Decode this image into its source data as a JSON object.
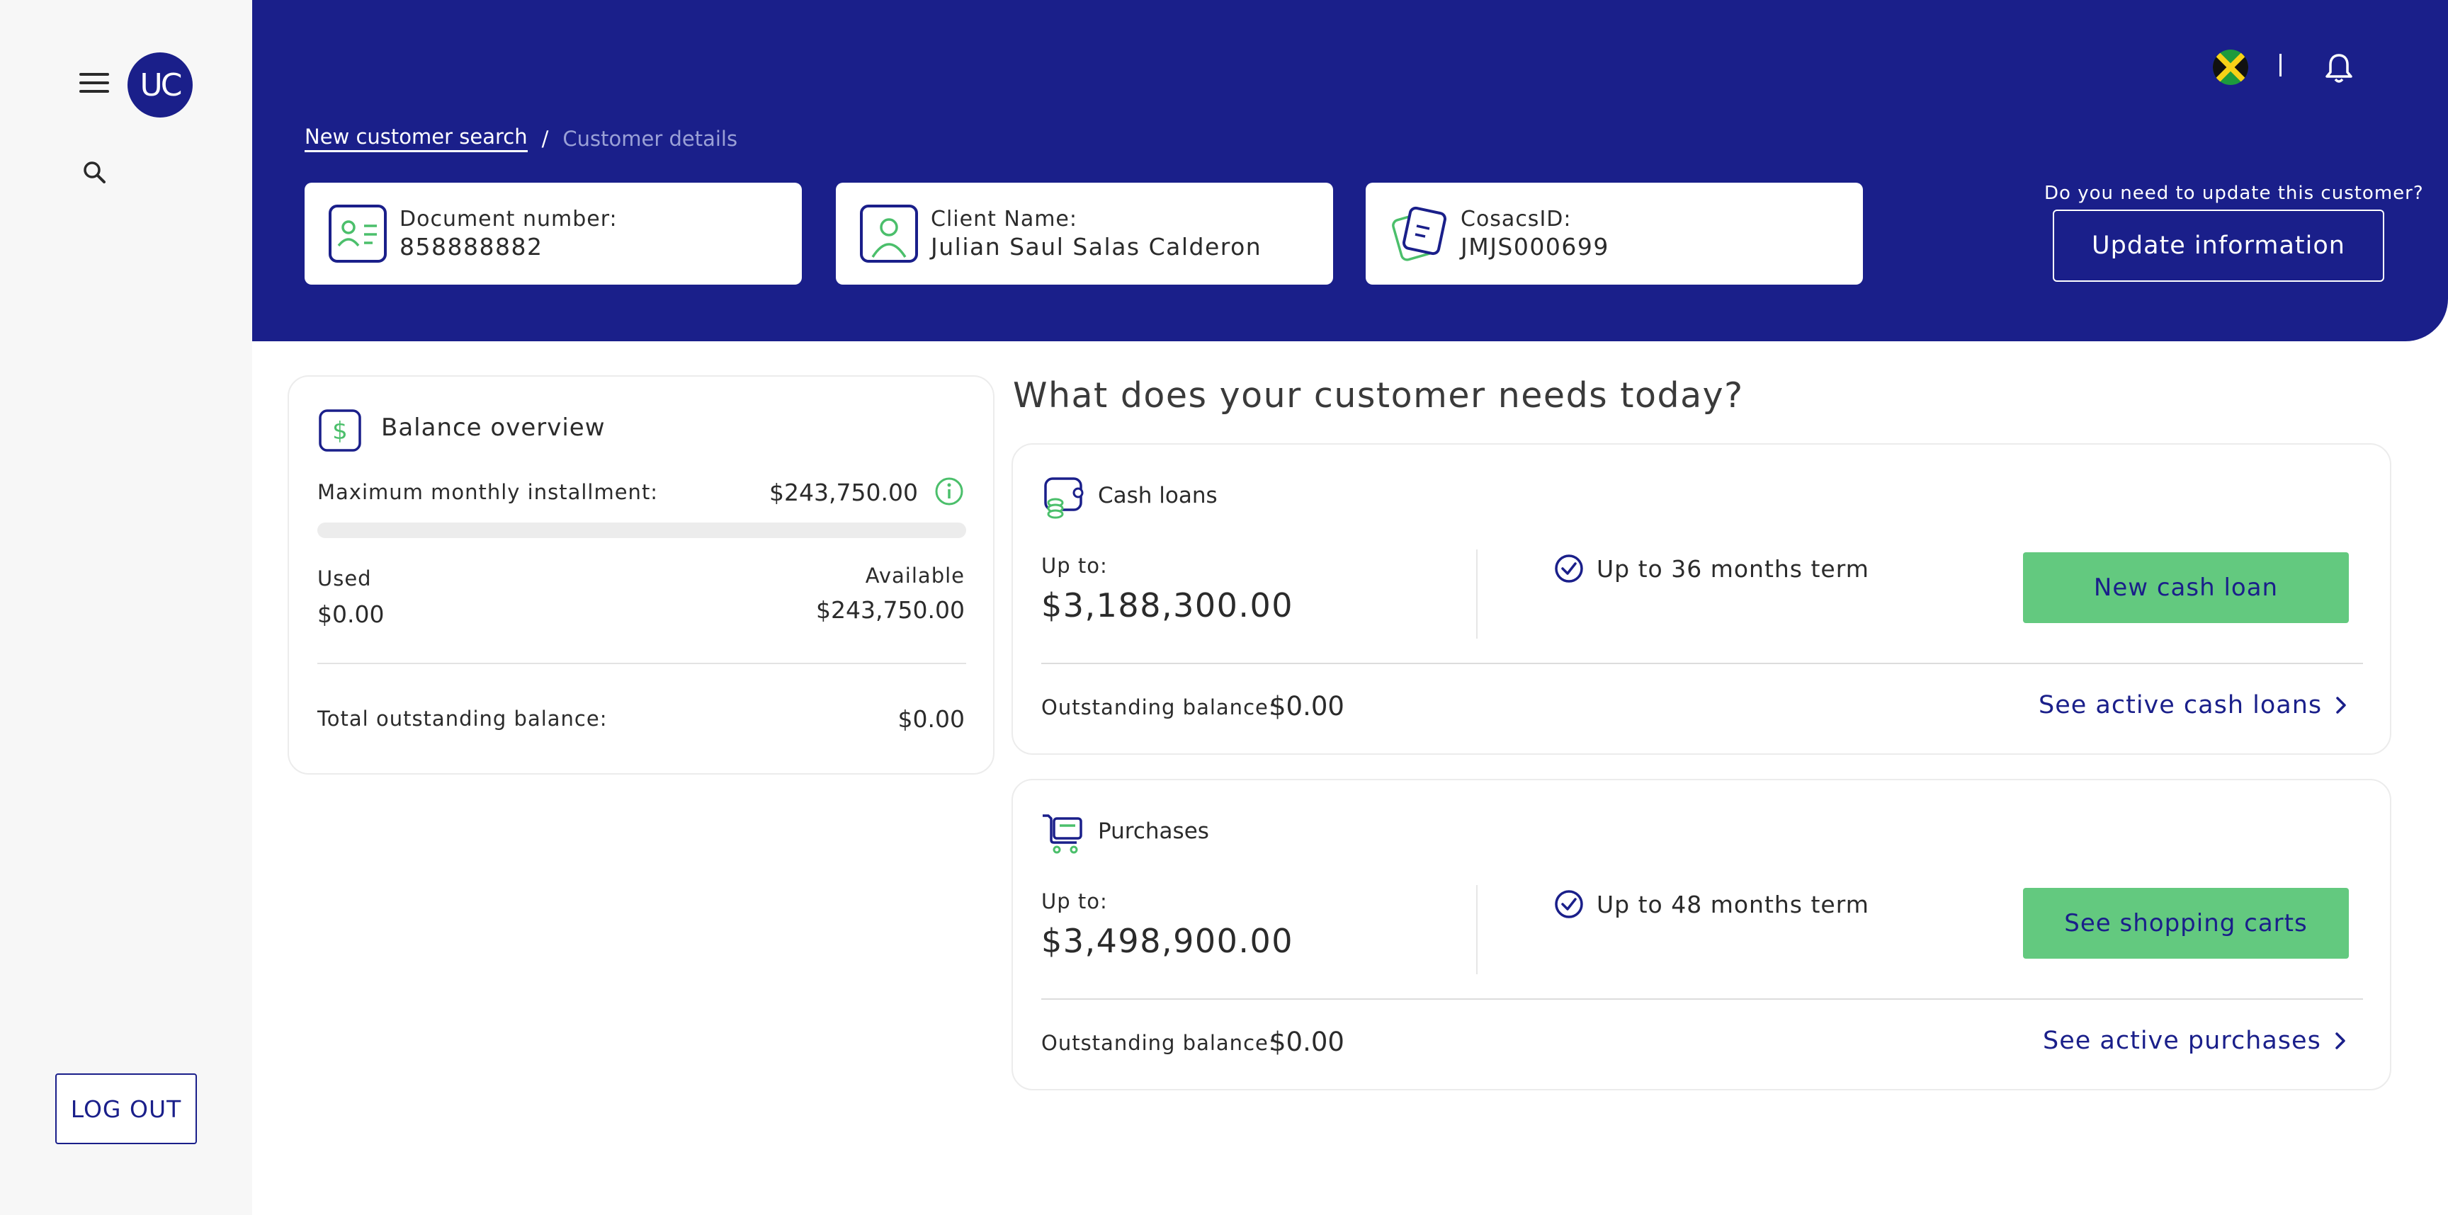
{
  "sidebar": {
    "avatar_text": "UC",
    "logout_label": "LOG OUT"
  },
  "header": {
    "breadcrumb": {
      "link": "New customer search",
      "separator": "/",
      "current": "Customer details"
    },
    "cards": [
      {
        "label": "Document number:",
        "value": "858888882",
        "icon": "id-card-icon"
      },
      {
        "label": "Client Name:",
        "value": "Julian Saul Salas Calderon",
        "icon": "user-icon"
      },
      {
        "label": "CosacsID:",
        "value": "JMJS000699",
        "icon": "document-icon"
      }
    ],
    "update_question": "Do you need to update this customer?",
    "update_button": "Update information",
    "flag": "jamaica-flag-icon",
    "notifications_icon": "bell-icon"
  },
  "balance": {
    "title": "Balance overview",
    "max_label": "Maximum monthly installment:",
    "max_value": "$243,750.00",
    "used_fraction": 0,
    "used_label": "Used",
    "used_value": "$0.00",
    "available_label": "Available",
    "available_value": "$243,750.00",
    "total_label": "Total outstanding balance:",
    "total_value": "$0.00"
  },
  "needs": {
    "title": "What does your customer needs today?",
    "products": [
      {
        "name": "Cash loans",
        "icon": "cash-loan-icon",
        "upto_label": "Up to:",
        "upto_value": "$3,188,300.00",
        "term": "Up to 36 months term",
        "button": "New cash loan",
        "outstanding_label": "Outstanding balance:",
        "outstanding_value": "$0.00",
        "link": "See active cash loans"
      },
      {
        "name": "Purchases",
        "icon": "shopping-cart-icon",
        "upto_label": "Up to:",
        "upto_value": "$3,498,900.00",
        "term": "Up to 48 months term",
        "button": "See shopping carts",
        "outstanding_label": "Outstanding balance:",
        "outstanding_value": "$0.00",
        "link": "See active purchases"
      }
    ]
  },
  "colors": {
    "primary": "#1a1f8a",
    "accent_green": "#63c97f",
    "icon_green": "#4bbf6b",
    "background": "#ffffff",
    "sidebar_bg": "#f7f7f7"
  }
}
